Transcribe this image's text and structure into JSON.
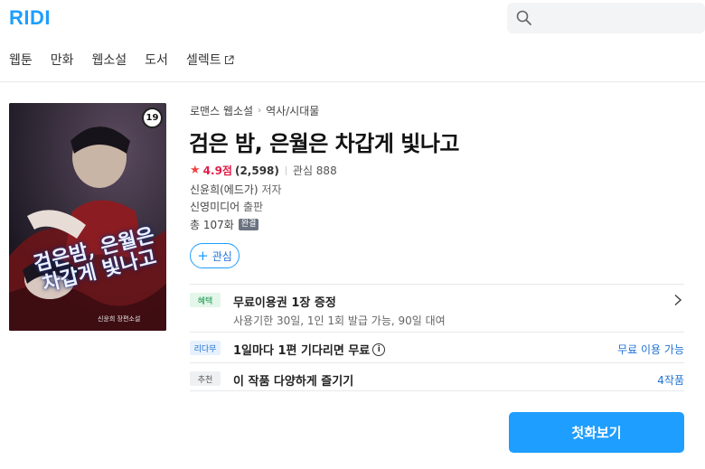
{
  "header": {
    "logo": "RIDI",
    "search_placeholder": ""
  },
  "nav": {
    "tabs": [
      {
        "label": "웹툰"
      },
      {
        "label": "만화"
      },
      {
        "label": "웹소설"
      },
      {
        "label": "도서"
      },
      {
        "label": "셀렉트",
        "icon": "external-link-icon"
      }
    ]
  },
  "book": {
    "cover": {
      "title_art": "검은밤, 은월은차갑게 빛나고",
      "author_art": "신윤희 장편소설",
      "age_rating": "19"
    },
    "breadcrumb": [
      "로맨스 웹소설",
      "역사/시대물"
    ],
    "title": "검은 밤, 은월은 차갑게 빛나고",
    "rating": {
      "star_icon": "star-icon",
      "score": "4.9점",
      "count": "(2,598)",
      "favorites": "관심 888"
    },
    "author": {
      "name": "신윤희(에드가)",
      "role": "저자"
    },
    "publisher": {
      "name": "신영미디어",
      "role": "출판"
    },
    "episodes": {
      "text": "총 107화",
      "badge": "완결"
    },
    "favorite_button": "관심"
  },
  "rows": {
    "benefit": {
      "tag": "혜택",
      "title": "무료이용권 1장 증정",
      "detail": "사용기한 30일, 1인 1회 발급 가능, 90일 대여"
    },
    "wait_free": {
      "tag": "리다무",
      "title": "1일마다 1편 기다리면 무료",
      "info_icon": "i",
      "action": "무료 이용 가능"
    },
    "recommend": {
      "tag": "추천",
      "title": "이 작품 다양하게 즐기기",
      "action": "4작품"
    }
  },
  "cta": {
    "label": "첫화보기"
  },
  "colors": {
    "brand": "#1e9eff",
    "rating": "#e11d48",
    "link": "#1e73d4"
  }
}
